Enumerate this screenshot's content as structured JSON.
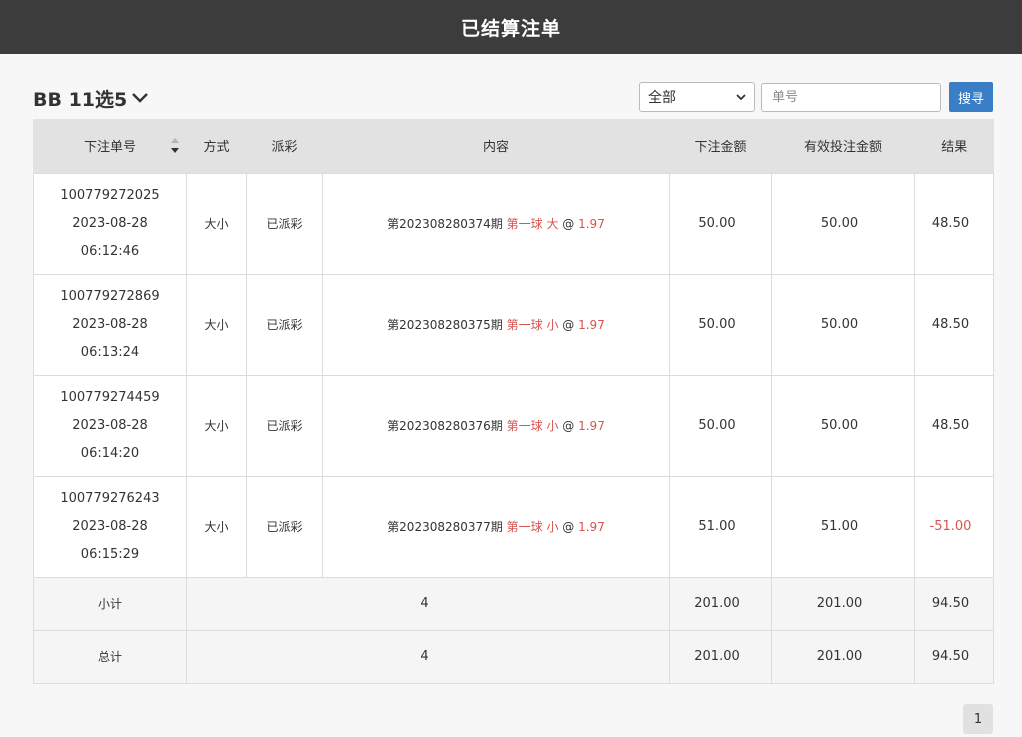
{
  "header": {
    "title": "已结算注单"
  },
  "game_selector": {
    "label": "BB 11选5"
  },
  "filter": {
    "selected": "全部"
  },
  "search": {
    "placeholder": "单号",
    "button_label": "搜寻"
  },
  "table": {
    "columns": [
      "下注单号",
      "方式",
      "派彩",
      "内容",
      "下注金额",
      "有效投注金额",
      "结果"
    ],
    "rows": [
      {
        "id": "100779272025",
        "date": "2023-08-28",
        "time": "06:12:46",
        "method": "大小",
        "status": "已派彩",
        "period": "第202308280374期",
        "pick": "第一球 大",
        "at": "@",
        "odds": "1.97",
        "amount": "50.00",
        "valid": "50.00",
        "result": "48.50",
        "result_negative": false
      },
      {
        "id": "100779272869",
        "date": "2023-08-28",
        "time": "06:13:24",
        "method": "大小",
        "status": "已派彩",
        "period": "第202308280375期",
        "pick": "第一球 小",
        "at": "@",
        "odds": "1.97",
        "amount": "50.00",
        "valid": "50.00",
        "result": "48.50",
        "result_negative": false
      },
      {
        "id": "100779274459",
        "date": "2023-08-28",
        "time": "06:14:20",
        "method": "大小",
        "status": "已派彩",
        "period": "第202308280376期",
        "pick": "第一球 小",
        "at": "@",
        "odds": "1.97",
        "amount": "50.00",
        "valid": "50.00",
        "result": "48.50",
        "result_negative": false
      },
      {
        "id": "100779276243",
        "date": "2023-08-28",
        "time": "06:15:29",
        "method": "大小",
        "status": "已派彩",
        "period": "第202308280377期",
        "pick": "第一球 小",
        "at": "@",
        "odds": "1.97",
        "amount": "51.00",
        "valid": "51.00",
        "result": "-51.00",
        "result_negative": true
      }
    ],
    "subtotal": {
      "label": "小计",
      "count": "4",
      "amount": "201.00",
      "valid": "201.00",
      "result": "94.50"
    },
    "total": {
      "label": "总计",
      "count": "4",
      "amount": "201.00",
      "valid": "201.00",
      "result": "94.50"
    }
  },
  "pagination": {
    "current": "1"
  },
  "colors": {
    "header_bg": "#3c3c3c",
    "button_blue": "#3a7fc6",
    "accent_red": "#d9534f"
  }
}
